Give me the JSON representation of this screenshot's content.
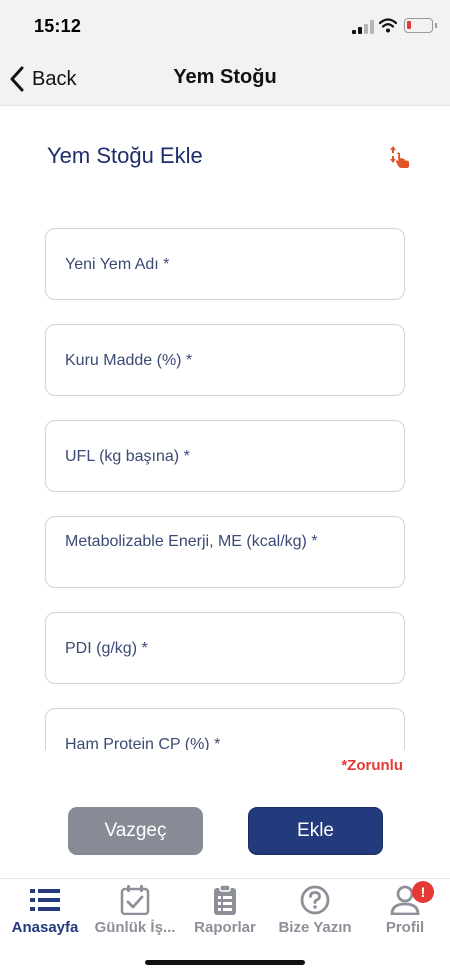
{
  "status_bar": {
    "time": "15:12"
  },
  "nav": {
    "back_label": "Back",
    "title": "Yem Stoğu"
  },
  "form": {
    "title": "Yem Stoğu Ekle",
    "fields": [
      {
        "label": "Yeni Yem Adı *"
      },
      {
        "label": "Kuru Madde (%) *"
      },
      {
        "label": "UFL (kg başına) *"
      },
      {
        "label": "Metabolizable Enerji, ME (kcal/kg) *"
      },
      {
        "label": "PDI (g/kg) *"
      },
      {
        "label": "Ham Protein CP (%) *"
      }
    ],
    "required_note": "*Zorunlu"
  },
  "actions": {
    "cancel_label": "Vazgeç",
    "add_label": "Ekle"
  },
  "tab_bar": {
    "tabs": [
      {
        "label": "Anasayfa",
        "icon": "list-icon",
        "active": true
      },
      {
        "label": "Günlük İş...",
        "icon": "calendar-check-icon"
      },
      {
        "label": "Raporlar",
        "icon": "clipboard-icon"
      },
      {
        "label": "Bize Yazın",
        "icon": "question-circle-icon"
      },
      {
        "label": "Profil",
        "icon": "user-icon",
        "badge": "!"
      }
    ]
  },
  "colors": {
    "primary": "#233a7d",
    "cancel": "#878b95",
    "required": "#e53935",
    "badge": "#e53935"
  }
}
